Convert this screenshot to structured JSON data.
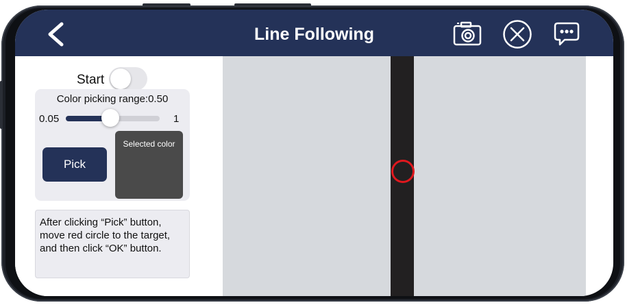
{
  "header": {
    "title": "Line Following",
    "back_icon": "chevron-left-icon",
    "camera_icon": "camera-switch-icon",
    "close_icon": "close-circle-icon",
    "chat_icon": "chat-bubble-icon",
    "background_color": "#243258"
  },
  "controls": {
    "start_label": "Start",
    "start_on": false,
    "range_label": "Color picking range:0.50",
    "slider_min": "0.05",
    "slider_max": "1",
    "slider_value": 0.5,
    "pick_label": "Pick",
    "selected_color_label": "Selected color",
    "selected_color": "#4a4a4a"
  },
  "instructions": "After clicking “Pick” button, move red circle to the target, and then click “OK” button.",
  "camera_view": {
    "background_color": "#d6d9dd",
    "line_color": "#222021",
    "circle_color": "#e0181e"
  }
}
